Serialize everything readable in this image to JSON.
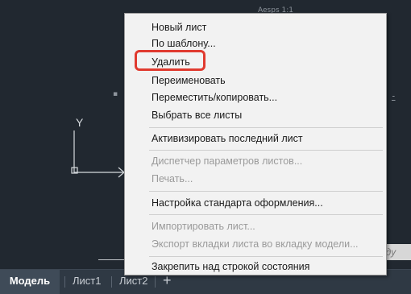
{
  "drawing": {
    "annotation_top": "Aesps 1:1",
    "hint_partial": "нду"
  },
  "ucs": {
    "y_label": "Y"
  },
  "tabs": {
    "model": "Модель",
    "sheet1": "Лист1",
    "sheet2": "Лист2",
    "add": "+"
  },
  "context_menu": {
    "items": [
      {
        "label": "Новый лист",
        "enabled": true
      },
      {
        "label": "По шаблону...",
        "enabled": true
      },
      {
        "label": "Удалить",
        "enabled": true,
        "highlighted": true
      },
      {
        "label": "Переименовать",
        "enabled": true
      },
      {
        "label": "Переместить/копировать...",
        "enabled": true
      },
      {
        "label": "Выбрать все листы",
        "enabled": true
      },
      {
        "label": "Активизировать последний лист",
        "enabled": true
      },
      {
        "label": "Диспетчер параметров листов...",
        "enabled": false
      },
      {
        "label": "Печать...",
        "enabled": false
      },
      {
        "label": "Настройка стандарта оформления...",
        "enabled": true
      },
      {
        "label": "Импортировать лист...",
        "enabled": false
      },
      {
        "label": "Экспорт вкладки листа во вкладку модели...",
        "enabled": false
      },
      {
        "label": "Закрепить над строкой состояния",
        "enabled": true
      }
    ]
  },
  "colors": {
    "highlight": "#e03a2f",
    "canvas": "#212830"
  }
}
